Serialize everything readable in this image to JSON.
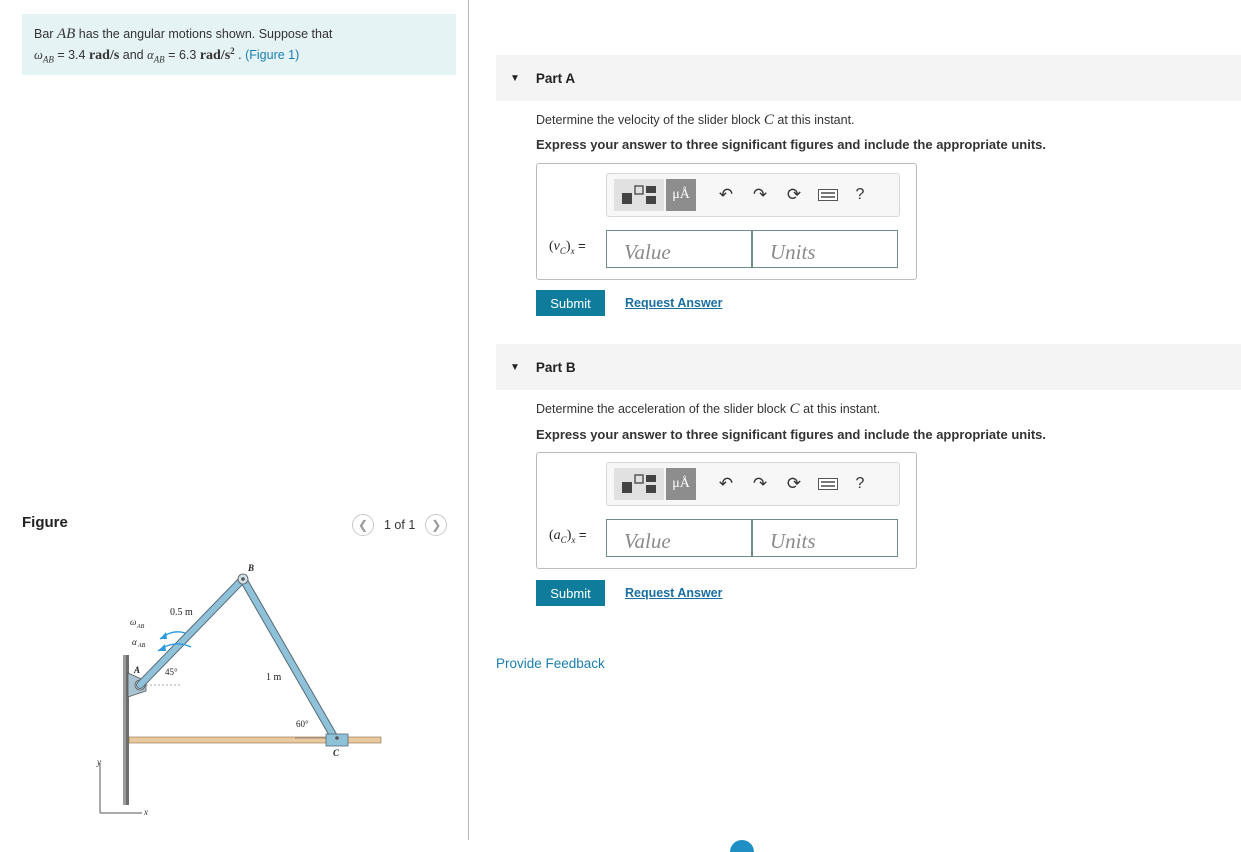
{
  "problem": {
    "intro": "Bar",
    "bar": "AB",
    "text1": "has the angular motions shown. Suppose that",
    "omega_sym": "ω",
    "omega_sub": "AB",
    "omega_val": "= 3.4",
    "omega_unit": "rad/s",
    "and_text": "and",
    "alpha_sym": "α",
    "alpha_sub": "AB",
    "alpha_val": "= 6.3",
    "alpha_unit": "rad/s",
    "alpha_sup": "2",
    "period": ".",
    "figure_link": "(Figure 1)"
  },
  "figure_panel": {
    "label": "Figure",
    "pager_text": "1 of 1",
    "prev_icon": "chevron-left-icon",
    "next_icon": "chevron-right-icon",
    "labels": {
      "B": "B",
      "A": "A",
      "C": "C",
      "len_ab": "0.5 m",
      "len_bc": "1 m",
      "omega": "ω",
      "alpha": "α",
      "sub": "AB",
      "angle45": "45°",
      "angle60": "60°",
      "y": "y",
      "x": "x"
    }
  },
  "parts": [
    {
      "header": "Part A",
      "instruction_pre": "Determine the velocity of the slider block",
      "instruction_var": "C",
      "instruction_post": "at this instant.",
      "instruction_bold": "Express your answer to three significant figures and include the appropriate units.",
      "eq_open": "(",
      "eq_var": "v",
      "eq_sub": "C",
      "eq_close": ")",
      "eq_comp": "x",
      "eq_equals": "=",
      "value_placeholder": "Value",
      "units_placeholder": "Units",
      "mu_label": "μÅ",
      "help_label": "?",
      "submit": "Submit",
      "request": "Request Answer"
    },
    {
      "header": "Part B",
      "instruction_pre": "Determine the acceleration of the slider block",
      "instruction_var": "C",
      "instruction_post": "at this instant.",
      "instruction_bold": "Express your answer to three significant figures and include the appropriate units.",
      "eq_open": "(",
      "eq_var": "a",
      "eq_sub": "C",
      "eq_close": ")",
      "eq_comp": "x",
      "eq_equals": "=",
      "value_placeholder": "Value",
      "units_placeholder": "Units",
      "mu_label": "μÅ",
      "help_label": "?",
      "submit": "Submit",
      "request": "Request Answer"
    }
  ],
  "feedback": "Provide Feedback",
  "colors": {
    "accent": "#0f7c9c",
    "link": "#1a7eaf",
    "problem_bg": "#e6f3f5",
    "header_bg": "#f4f4f4"
  }
}
